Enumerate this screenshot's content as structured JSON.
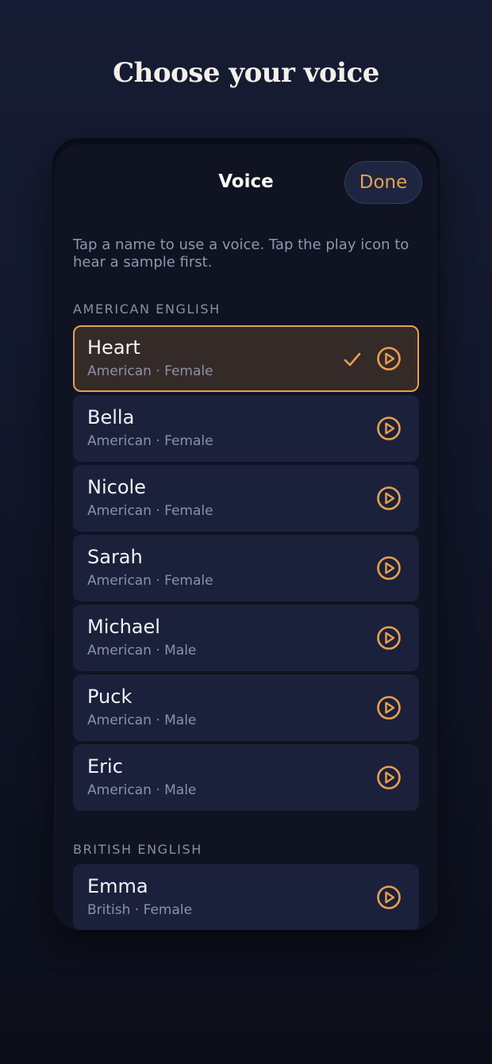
{
  "headline": "Choose your voice",
  "sheet": {
    "title": "Voice",
    "done_label": "Done",
    "hint": "Tap a name to use a voice. Tap the play icon to hear a sample first."
  },
  "sections": [
    {
      "label": "AMERICAN ENGLISH",
      "voices": [
        {
          "name": "Heart",
          "details": "American · Female",
          "selected": true
        },
        {
          "name": "Bella",
          "details": "American · Female",
          "selected": false
        },
        {
          "name": "Nicole",
          "details": "American · Female",
          "selected": false
        },
        {
          "name": "Sarah",
          "details": "American · Female",
          "selected": false
        },
        {
          "name": "Michael",
          "details": "American · Male",
          "selected": false
        },
        {
          "name": "Puck",
          "details": "American · Male",
          "selected": false
        },
        {
          "name": "Eric",
          "details": "American · Male",
          "selected": false
        }
      ]
    },
    {
      "label": "BRITISH ENGLISH",
      "voices": [
        {
          "name": "Emma",
          "details": "British · Female",
          "selected": false
        }
      ]
    }
  ],
  "icons": {
    "play": "play-circle-icon",
    "selected": "checkmark-icon"
  },
  "colors": {
    "accent": "#e8a04e",
    "row_background": "#1b213a",
    "selected_row_background": "#342b28",
    "sheet_background": "#0f1322"
  }
}
